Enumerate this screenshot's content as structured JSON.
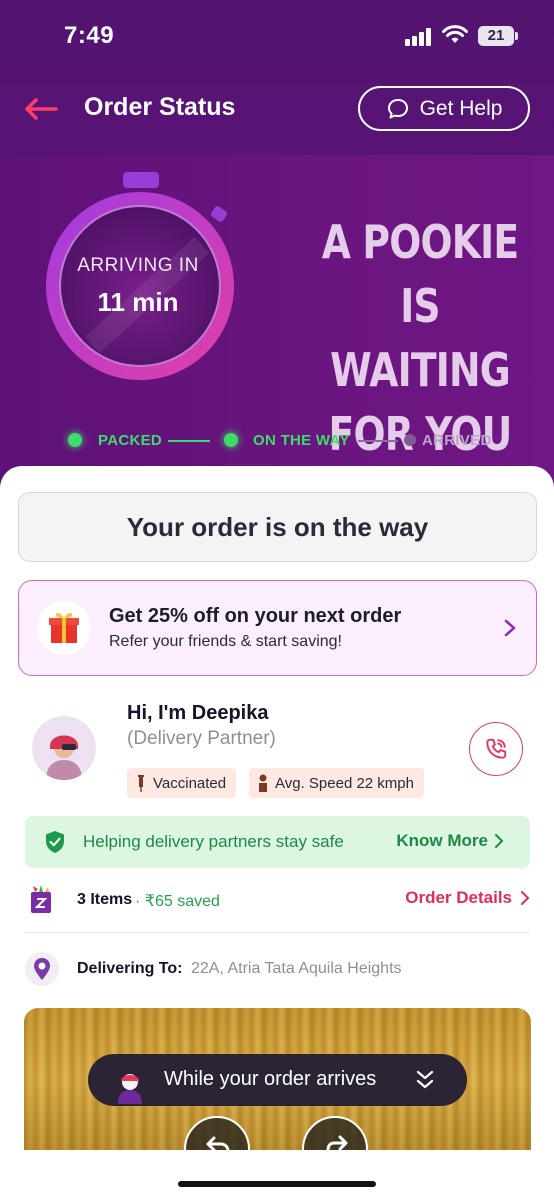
{
  "status_bar": {
    "time": "7:49",
    "battery": "21"
  },
  "header": {
    "title": "Order Status",
    "help_label": "Get Help"
  },
  "timer": {
    "label": "ARRIVING IN",
    "value": "11 min"
  },
  "tagline": {
    "line1": "A POOKIE",
    "line2": "IS WAITING",
    "line3": "FOR YOU"
  },
  "steps": [
    {
      "label": "PACKED",
      "state": "done"
    },
    {
      "label": "ON THE WAY",
      "state": "done"
    },
    {
      "label": "ARRIVED",
      "state": "pending"
    }
  ],
  "order_status": {
    "text": "Your order is on the way"
  },
  "referral": {
    "title": "Get 25% off on your next order",
    "subtitle": "Refer your friends & start saving!"
  },
  "partner": {
    "name": "Hi, I'm Deepika",
    "role": "(Delivery Partner)",
    "chips": [
      "Vaccinated",
      "Avg. Speed 22 kmph"
    ]
  },
  "safety": {
    "text": "Helping delivery partners stay safe",
    "link": "Know More"
  },
  "order_summary": {
    "items": "3 Items",
    "separator": "·",
    "saved": "₹65 saved",
    "details_link": "Order Details"
  },
  "delivery": {
    "label": "Delivering To:",
    "address": "22A, Atria Tata Aquila Heights"
  },
  "video": {
    "pill_text": "While your order arrives"
  },
  "colors": {
    "purple": "#5c1478",
    "accent_pink": "#e02e56",
    "green": "#3ddc6a",
    "success_text": "#1c8a44"
  }
}
